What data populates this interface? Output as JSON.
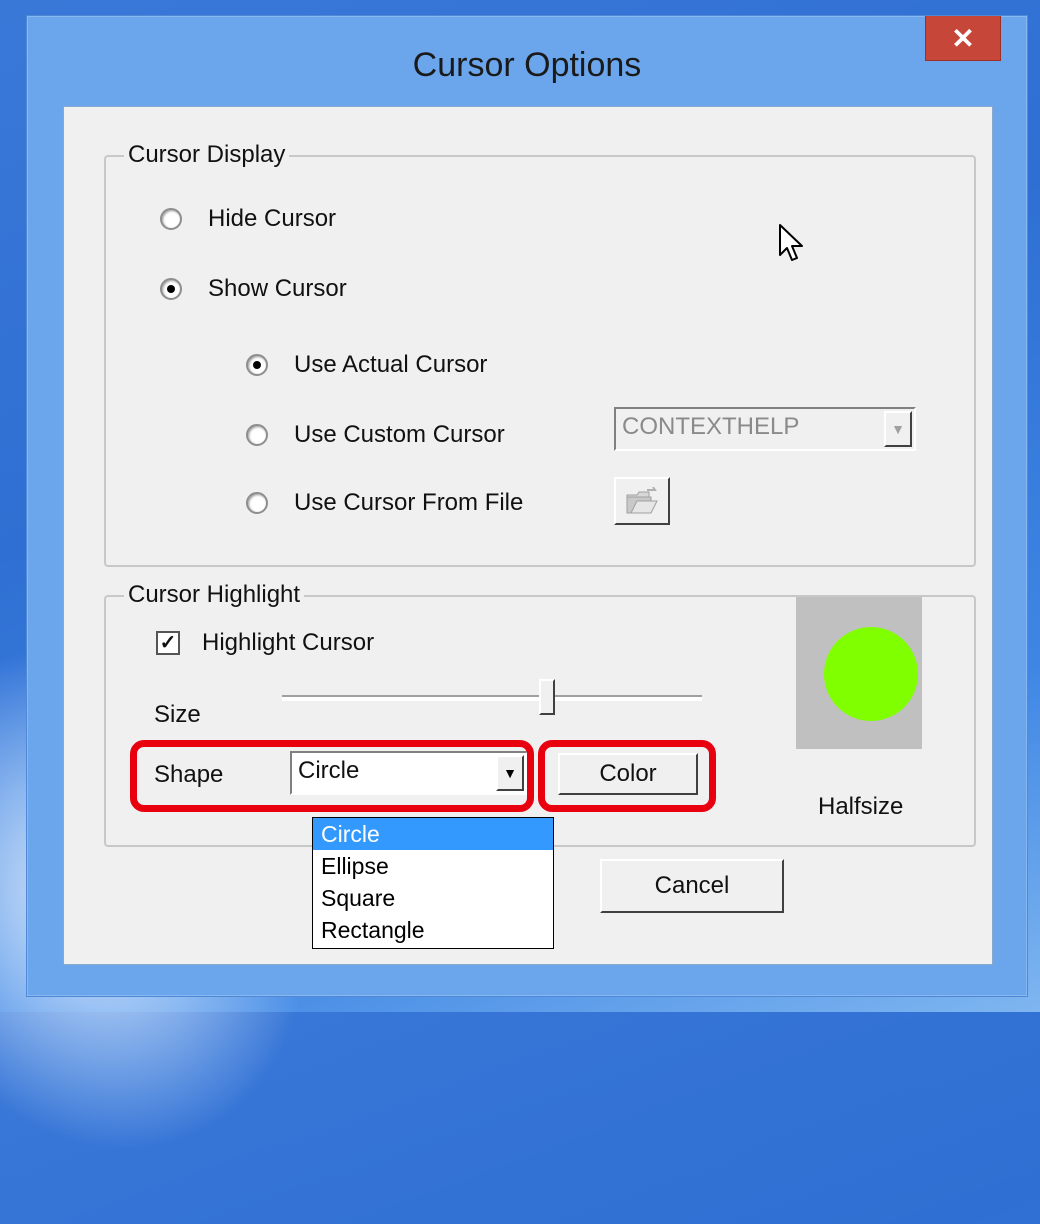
{
  "window": {
    "title": "Cursor Options",
    "close_label": "✕"
  },
  "cursor_display": {
    "label": "Cursor Display",
    "hide_cursor": "Hide Cursor",
    "show_cursor": "Show Cursor",
    "use_actual": "Use Actual Cursor",
    "use_custom": "Use Custom Cursor",
    "use_file": "Use Cursor From File",
    "custom_cursor_value": "CONTEXTHELP",
    "selected_mode": "Show Cursor",
    "selected_submode": "Use Actual Cursor"
  },
  "cursor_highlight": {
    "label": "Cursor Highlight",
    "highlight_checkbox": "Highlight Cursor",
    "highlight_checked": true,
    "size_label": "Size",
    "size_value_fraction": 0.63,
    "shape_label": "Shape",
    "shape_value": "Circle",
    "shape_options": [
      "Circle",
      "Ellipse",
      "Square",
      "Rectangle"
    ],
    "color_button": "Color",
    "preview_caption": "Halfsize",
    "preview_color": "#7fff00"
  },
  "footer": {
    "cancel_button": "Cancel"
  },
  "colors": {
    "highlight_annotation": "#e8000f",
    "titlebar": "#6ba6ec",
    "close_button": "#c7463a"
  }
}
